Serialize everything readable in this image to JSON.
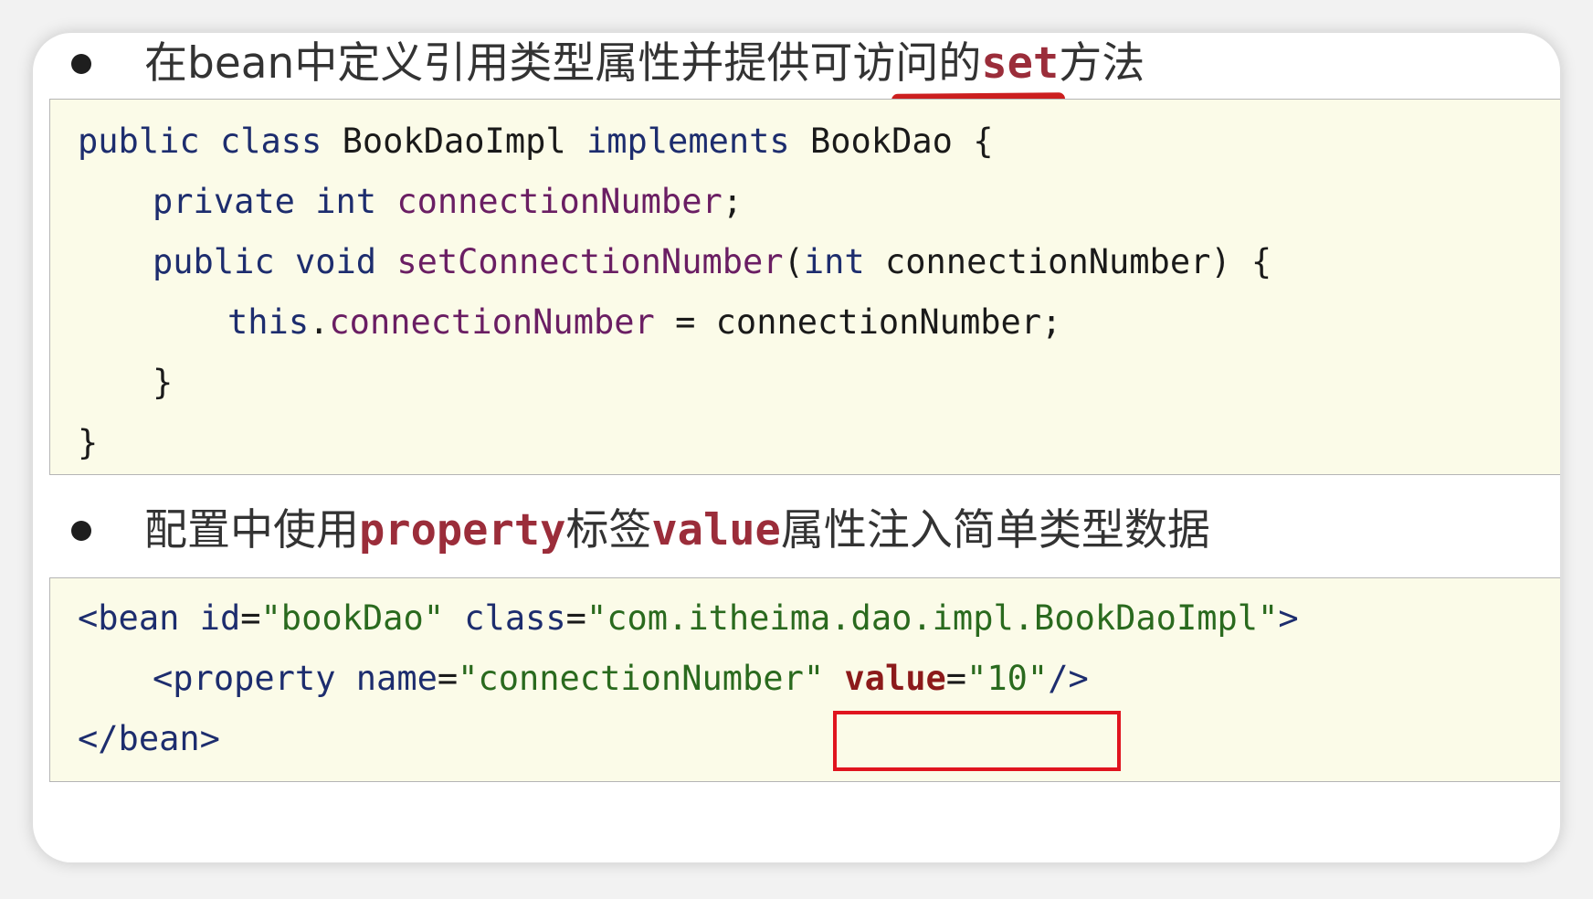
{
  "bullet1": {
    "text_before": "在bean中定义引用类型属性并提供可访问的",
    "keyword": "set",
    "text_after": "方法"
  },
  "code1": {
    "line1": {
      "kw1": "public",
      "kw2": "class",
      "name": "BookDaoImpl",
      "kw3": "implements",
      "iface": "BookDao",
      "brace": "{"
    },
    "line2": {
      "kw1": "private",
      "kw2": "int",
      "field": "connectionNumber",
      "end": ";"
    },
    "line3": {
      "kw1": "public",
      "kw2": "void",
      "method": "setConnectionNumber",
      "paren": "(",
      "kw3": "int",
      "param": "connectionNumber) {"
    },
    "line4": {
      "kw": "this",
      "dot": ".",
      "field": "connectionNumber",
      "rest": " = connectionNumber;"
    },
    "line5": "}",
    "line6": "}"
  },
  "bullet2": {
    "text1": "配置中使用",
    "kw1": "property",
    "text2": "标签",
    "kw2": "value",
    "text3": "属性注入简单类型数据"
  },
  "code2": {
    "line1": {
      "open": "<bean",
      "attr1": "id",
      "eq1": "=",
      "val1": "\"bookDao\"",
      "attr2": "class",
      "eq2": "=",
      "val2": "\"com.itheima.dao.impl.BookDaoImpl\"",
      "close": ">"
    },
    "line2": {
      "open": "<property",
      "attr1": "name",
      "eq1": "=",
      "val1": "\"connectionNumber\"",
      "attr2": "value",
      "eq2": "=",
      "val2": "\"10\"",
      "close": "/>"
    },
    "line3": "</bean>"
  },
  "colors": {
    "underline": "#cc1f1f",
    "highlight_box": "#e0141e"
  }
}
